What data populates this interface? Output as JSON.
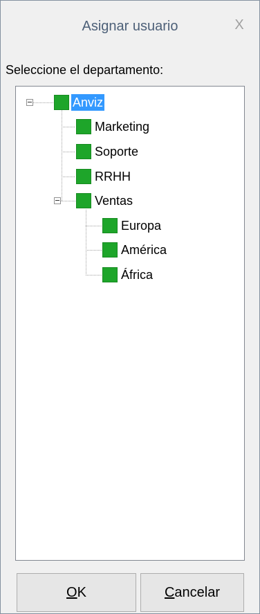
{
  "window": {
    "title": "Asignar usuario",
    "close_glyph": "X"
  },
  "prompt": "Seleccione el departamento:",
  "tree": {
    "root": {
      "label": "Anviz",
      "selected": true,
      "expanded": true,
      "icon": "green-square",
      "children": [
        {
          "label": "Marketing"
        },
        {
          "label": "Soporte"
        },
        {
          "label": "RRHH"
        },
        {
          "label": "Ventas",
          "expanded": true,
          "children": [
            {
              "label": "Europa"
            },
            {
              "label": "América"
            },
            {
              "label": "África"
            }
          ]
        }
      ]
    },
    "node_color": "#1ea52a",
    "selection_color": "#3399ff"
  },
  "buttons": {
    "ok": {
      "mnemonic": "O",
      "rest": "K"
    },
    "cancel": {
      "mnemonic": "C",
      "rest": "ancelar"
    }
  }
}
